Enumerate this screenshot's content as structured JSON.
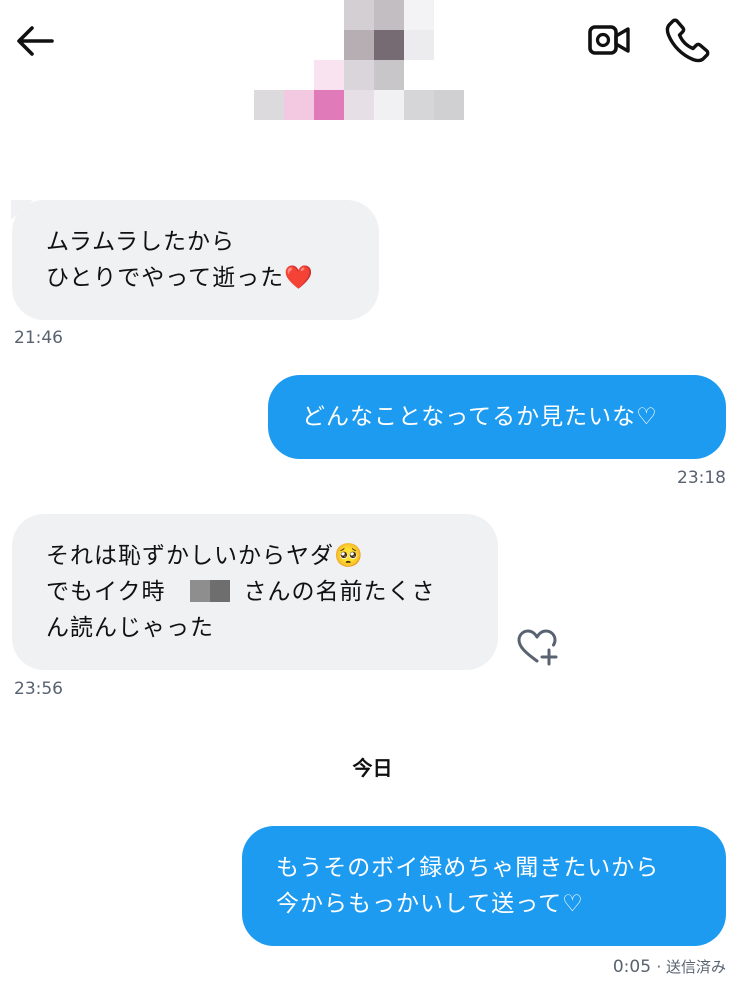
{
  "header": {
    "back_icon": "arrow-left-icon",
    "video_icon": "video-camera-icon",
    "call_icon": "phone-icon",
    "avatar": "pixelated profile avatar"
  },
  "messages": [
    {
      "direction": "incoming",
      "lines": [
        "ムラムラしたから",
        "ひとりでやって逝った❤️"
      ],
      "time": "21:46"
    },
    {
      "direction": "outgoing",
      "lines": [
        "どんなことなってるか見たいな♡"
      ],
      "time": "23:18"
    },
    {
      "direction": "incoming",
      "lines": [
        "それは恥ずかしいからヤダ🥺",
        "でもイク時",
        "さんの名前たくさ",
        "ん読んじゃった"
      ],
      "time": "23:56",
      "reaction_icon": "heart-plus-icon"
    },
    {
      "direction": "outgoing",
      "lines": [
        "もうそのボイ録めちゃ聞きたいから",
        "今からもっかいして送って♡"
      ],
      "time": "0:05",
      "status": "· 送信済み"
    }
  ],
  "date_divider": "今日",
  "colors": {
    "outgoing_bubble": "#1d9bf0",
    "incoming_bubble": "#eff1f3",
    "timestamp": "#586270"
  }
}
